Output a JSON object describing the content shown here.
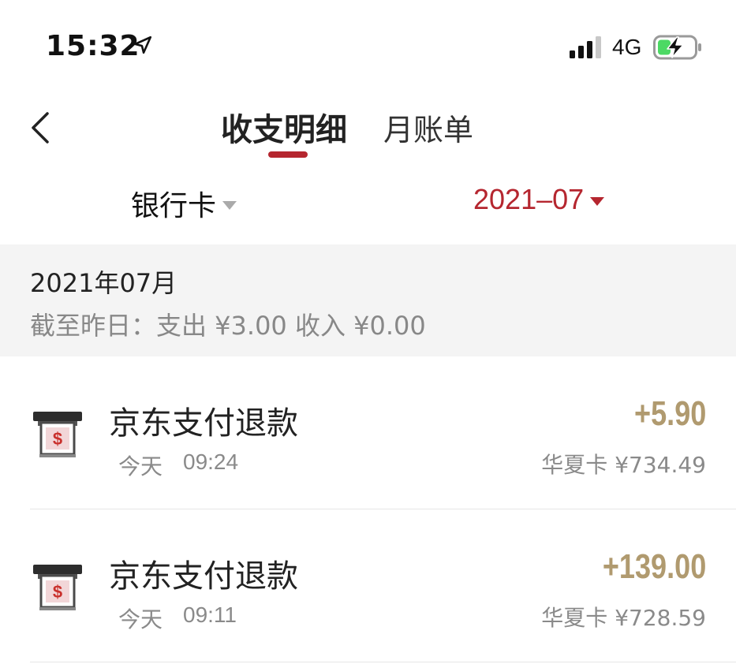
{
  "status_bar": {
    "time": "15:32",
    "network": "4G"
  },
  "nav": {
    "tab_active": "收支明细",
    "tab_other": "月账单"
  },
  "filter": {
    "card_label": "银行卡",
    "date_label": "2021–07"
  },
  "summary": {
    "month": "2021年07月",
    "line": "截至昨日：支出 ¥3.00 收入 ¥0.00"
  },
  "transactions": [
    {
      "title": "京东支付退款",
      "date": "今天",
      "time": "09:24",
      "amount": "+5.90",
      "balance": "华夏卡 ¥734.49"
    },
    {
      "title": "京东支付退款",
      "date": "今天",
      "time": "09:11",
      "amount": "+139.00",
      "balance": "华夏卡 ¥728.59"
    }
  ],
  "colors": {
    "accent": "#b5262f",
    "amount": "#b09a6f",
    "summary_bg": "#f4f4f4"
  },
  "icons": [
    "location-arrow-icon",
    "cellular-signal-icon",
    "battery-charging-icon",
    "back-chevron-icon",
    "atm-dollar-icon"
  ]
}
